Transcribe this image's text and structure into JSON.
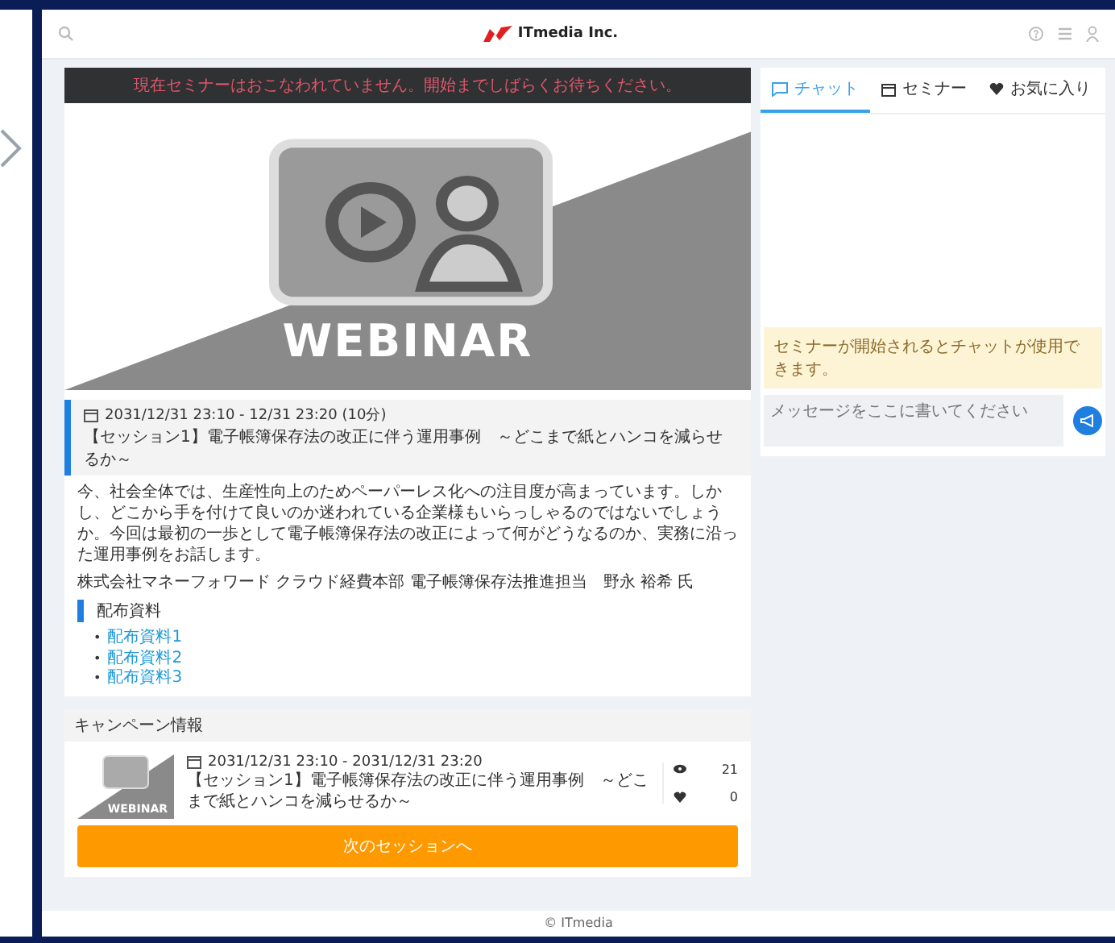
{
  "header": {
    "logo": "ITmedia Inc."
  },
  "alert": "現在セミナーはおこなわれていません。開始までしばらくお待ちください。",
  "banner": {
    "caption": "WEBINAR"
  },
  "session": {
    "datetime": "2031/12/31 23:10 - 12/31 23:20 (10分)",
    "title": "【セッション1】電子帳簿保存法の改正に伴う運用事例　～どこまで紙とハンコを減らせるか～",
    "description": "今、社会全体では、生産性向上のためペーパーレス化への注目度が高まっています。しかし、どこから手を付けて良いのか迷われている企業様もいらっしゃるのではないでしょうか。今回は最初の一歩として電子帳簿保存法の改正によって何がどうなるのか、実務に沿った運用事例をお話します。",
    "speaker": "株式会社マネーフォワード クラウド経費本部 電子帳簿保存法推進担当　野永 裕希 氏",
    "materials_heading": "配布資料",
    "materials": [
      {
        "bullet": "•",
        "label": "配布資料1"
      },
      {
        "bullet": "•",
        "label": "配布資料2"
      },
      {
        "bullet": "•",
        "label": "配布資料3"
      }
    ]
  },
  "campaign": {
    "heading": "キャンペーン情報",
    "item": {
      "thumbnail_caption": "WEBINAR",
      "datetime": "2031/12/31 23:10 - 2031/12/31 23:20",
      "title": "【セッション1】電子帳簿保存法の改正に伴う運用事例　～どこまで紙とハンコを減らせるか～",
      "views": "21",
      "likes": "0"
    },
    "next_button": "次のセッションへ"
  },
  "tabs": [
    {
      "label": "チャット",
      "kind": "chat",
      "selected": true
    },
    {
      "label": "セミナー",
      "kind": "seminar",
      "selected": false
    },
    {
      "label": "お気に入り",
      "kind": "favorite",
      "selected": false
    }
  ],
  "chat": {
    "notice": "セミナーが開始されるとチャットが使用できます。",
    "placeholder": "メッセージをここに書いてください"
  },
  "footer": "© ITmedia"
}
